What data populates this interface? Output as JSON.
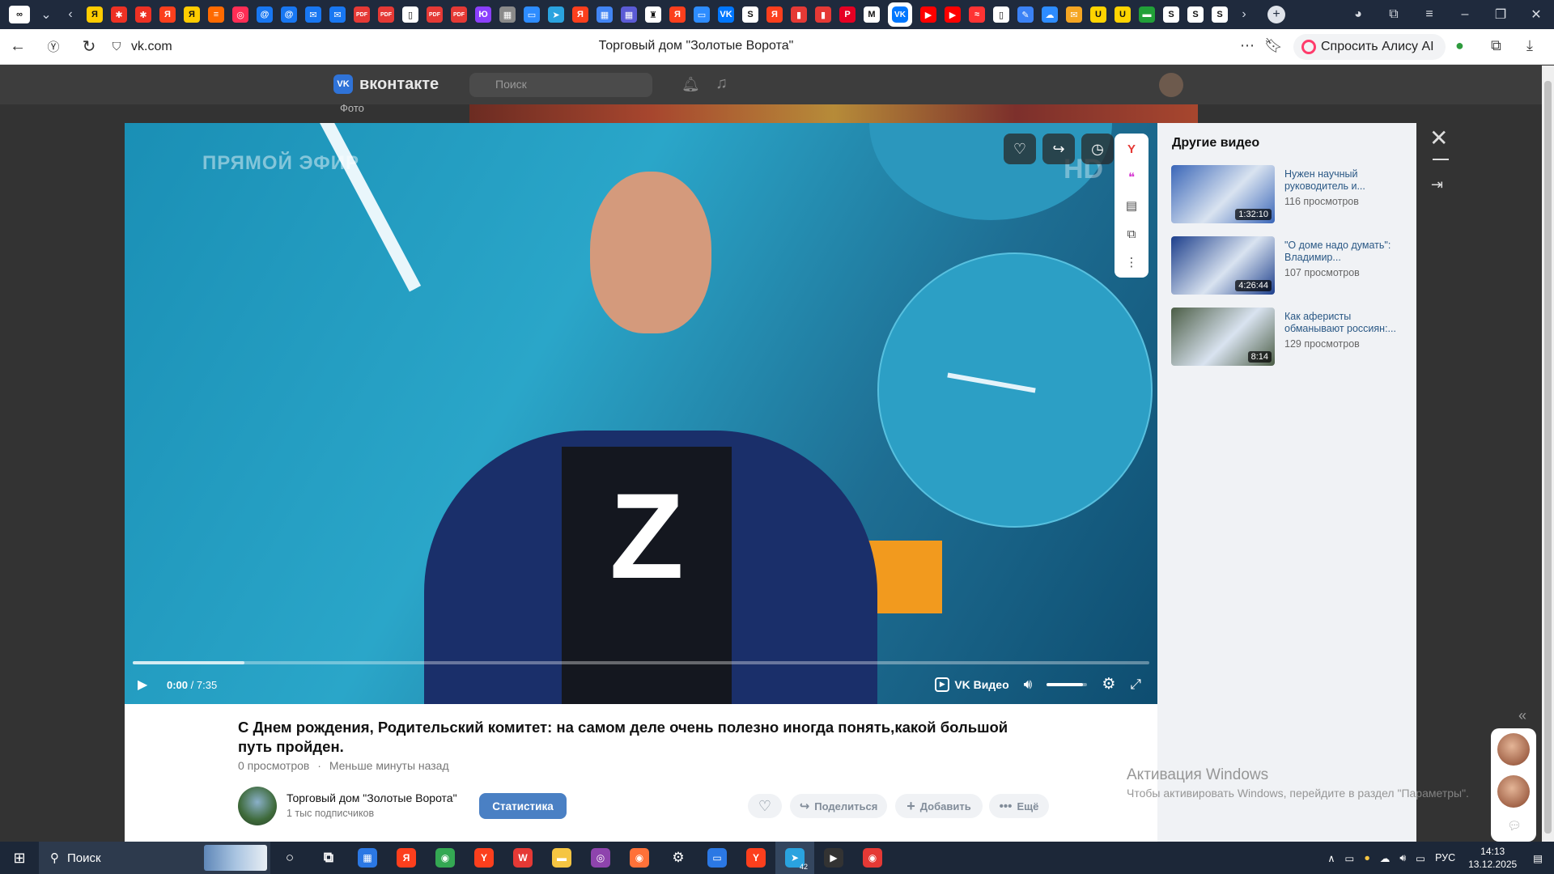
{
  "browser": {
    "tab_favicons": [
      {
        "icon": "dzen-icon",
        "color": "#ffcc00",
        "label": "Я"
      },
      {
        "icon": "gosuslugi-icon",
        "color": "#ee3124",
        "label": "✱"
      },
      {
        "icon": "gosuslugi-icon",
        "color": "#ee3124",
        "label": "✱"
      },
      {
        "icon": "yandex-icon",
        "color": "#fc3f1d",
        "label": "Я"
      },
      {
        "icon": "dzen-icon",
        "color": "#ffcc00",
        "label": "Я"
      },
      {
        "icon": "chart-icon",
        "color": "#ff6a00",
        "label": "≡"
      },
      {
        "icon": "ozon-icon",
        "color": "#ff2d55",
        "label": "◎"
      },
      {
        "icon": "mail-icon",
        "color": "#1877f2",
        "label": "@"
      },
      {
        "icon": "mail-icon",
        "color": "#1877f2",
        "label": "@"
      },
      {
        "icon": "mail-icon",
        "color": "#1877f2",
        "label": "✉"
      },
      {
        "icon": "mail-icon",
        "color": "#1877f2",
        "label": "✉"
      },
      {
        "icon": "pdf-icon",
        "color": "#e53935",
        "label": "PDF"
      },
      {
        "icon": "pdf-icon",
        "color": "#e53935",
        "label": "PDF"
      },
      {
        "icon": "doc-icon",
        "color": "#ffffff",
        "label": "▯"
      },
      {
        "icon": "pdf-icon",
        "color": "#e53935",
        "label": "PDF"
      },
      {
        "icon": "pdf-icon",
        "color": "#e53935",
        "label": "PDF"
      },
      {
        "icon": "yumoney-icon",
        "color": "#8b3ffd",
        "label": "Ю"
      },
      {
        "icon": "apps-icon",
        "color": "#8a8a8a",
        "label": "▦"
      },
      {
        "icon": "chat-icon",
        "color": "#2d8cff",
        "label": "▭"
      },
      {
        "icon": "telegram-icon",
        "color": "#2aa3df",
        "label": "➤"
      },
      {
        "icon": "yandex-icon",
        "color": "#fc3f1d",
        "label": "Я"
      },
      {
        "icon": "grid-icon",
        "color": "#4285f4",
        "label": "▦"
      },
      {
        "icon": "calendar-icon",
        "color": "#5b5bd6",
        "label": "▦"
      },
      {
        "icon": "chess-icon",
        "color": "#ffffff",
        "label": "♜"
      },
      {
        "icon": "yandex-icon",
        "color": "#fc3f1d",
        "label": "Я"
      },
      {
        "icon": "chat-icon",
        "color": "#2d8cff",
        "label": "▭"
      },
      {
        "icon": "vk-icon",
        "color": "#0077ff",
        "label": "VK"
      },
      {
        "icon": "s-icon",
        "color": "#ffffff",
        "label": "S"
      },
      {
        "icon": "yandex-icon",
        "color": "#fc3f1d",
        "label": "Я"
      },
      {
        "icon": "flag-icon",
        "color": "#e53935",
        "label": "▮"
      },
      {
        "icon": "flag-icon",
        "color": "#e53935",
        "label": "▮"
      },
      {
        "icon": "pinterest-icon",
        "color": "#e60023",
        "label": "P"
      },
      {
        "icon": "m-icon",
        "color": "#ffffff",
        "label": "M"
      }
    ],
    "active_tab_icon": "VK",
    "tab_favicons_after": [
      {
        "icon": "youtube-icon",
        "color": "#ff0000",
        "label": "▶"
      },
      {
        "icon": "youtube-icon",
        "color": "#ff0000",
        "label": "▶"
      },
      {
        "icon": "rutube-icon",
        "color": "#ff3333",
        "label": "≈"
      },
      {
        "icon": "doc-icon",
        "color": "#ffffff",
        "label": "▯"
      },
      {
        "icon": "pen-icon",
        "color": "#3b82f6",
        "label": "✎"
      },
      {
        "icon": "cloud-icon",
        "color": "#2d8cff",
        "label": "☁"
      },
      {
        "icon": "mail-icon",
        "color": "#f5a623",
        "label": "✉"
      },
      {
        "icon": "u-icon",
        "color": "#ffd400",
        "label": "U"
      },
      {
        "icon": "u-icon",
        "color": "#ffd400",
        "label": "U"
      },
      {
        "icon": "sber-icon",
        "color": "#21a038",
        "label": "▬"
      },
      {
        "icon": "s-icon",
        "color": "#ffffff",
        "label": "S"
      },
      {
        "icon": "s-icon",
        "color": "#ffffff",
        "label": "S"
      },
      {
        "icon": "s-icon",
        "color": "#ffffff",
        "label": "S"
      }
    ],
    "url": "vk.com",
    "page_title": "Торговый дом \"Золотые Ворота\"",
    "ask_alice": "Спросить Алису AI"
  },
  "vk": {
    "logo_text": "вконтакте",
    "logo_mark": "VK",
    "search_placeholder": "Поиск",
    "side_link": "Фото"
  },
  "video": {
    "overlay_live": "ПРЯМОЙ ЭФИР",
    "overlay_hd": "HD",
    "overlay_letter": "Z",
    "time_current": "0:00",
    "time_total": "7:35",
    "time_sep": " / ",
    "buffered_fraction": 0.11,
    "volume_fraction": 0.9,
    "vk_video_label": "VK Видео",
    "title": "С Днем рождения, Родительский комитет: на самом деле очень полезно иногда понять,какой большой путь пройден.",
    "views": "0 просмотров",
    "dot": "·",
    "posted": "Меньше минуты назад",
    "channel_name": "Торговый дом \"Золотые Ворота\"",
    "channel_subs": "1 тыс подписчиков",
    "stats_button": "Статистика",
    "share_label": "Поделиться",
    "add_label": "Добавить",
    "more_label": "Ещё"
  },
  "other_videos": {
    "heading": "Другие видео",
    "items": [
      {
        "title": "Нужен научный руководитель и...",
        "views": "116 просмотров",
        "duration": "1:32:10",
        "thumb_color": "#3a66b8"
      },
      {
        "title": "\"О доме надо думать\": Владимир...",
        "views": "107 просмотров",
        "duration": "4:26:44",
        "thumb_color": "#1d3f8c"
      },
      {
        "title": "Как аферисты обманывают россиян:...",
        "views": "129 просмотров",
        "duration": "8:14",
        "thumb_color": "#4b5d45"
      }
    ]
  },
  "windows_activation": {
    "title": "Активация Windows",
    "subtitle": "Чтобы активировать Windows, перейдите в раздел \"Параметры\"."
  },
  "taskbar": {
    "search_label": "Поиск",
    "apps": [
      {
        "icon": "cortana-icon",
        "color": "transparent",
        "label": "○"
      },
      {
        "icon": "task-view-icon",
        "color": "transparent",
        "label": "⧉"
      },
      {
        "icon": "store-icon",
        "color": "#2b78e4",
        "label": "▦"
      },
      {
        "icon": "yandex-icon",
        "color": "#fc3f1d",
        "label": "Я"
      },
      {
        "icon": "chrome-icon",
        "color": "#34a853",
        "label": "◉"
      },
      {
        "icon": "yandex-browser-icon",
        "color": "#fc3f1d",
        "label": "Y"
      },
      {
        "icon": "wps-icon",
        "color": "#e53935",
        "label": "W"
      },
      {
        "icon": "folder-icon",
        "color": "#f5c542",
        "label": "▬"
      },
      {
        "icon": "disk-icon",
        "color": "#8e44ad",
        "label": "◎"
      },
      {
        "icon": "firefox-icon",
        "color": "#ff7139",
        "label": "◉"
      },
      {
        "icon": "settings-icon",
        "color": "transparent",
        "label": "⚙"
      },
      {
        "icon": "window-icon",
        "color": "#2b78e4",
        "label": "▭"
      },
      {
        "icon": "yandex-browser-icon",
        "color": "#fc3f1d",
        "label": "Y"
      },
      {
        "icon": "telegram-icon",
        "color": "#2aa3df",
        "label": "➤"
      },
      {
        "icon": "player-icon",
        "color": "#333333",
        "label": "▶"
      },
      {
        "icon": "colorful-icon",
        "color": "#e53935",
        "label": "◉"
      }
    ],
    "telegram_badge": "42",
    "lang": "РУС",
    "time": "14:13",
    "date": "13.12.2025"
  }
}
